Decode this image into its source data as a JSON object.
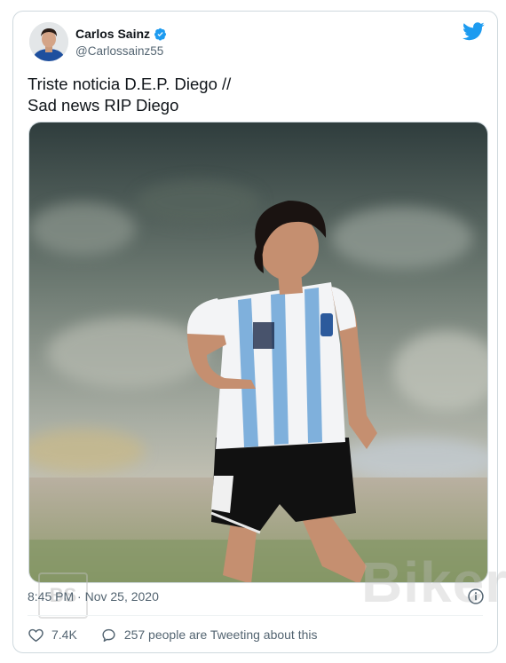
{
  "author": {
    "name": "Carlos Sainz",
    "handle": "@Carlossainz55",
    "verified": true
  },
  "tweet": {
    "text_lines": [
      "Triste noticia D.E.P. Diego //",
      "Sad news RIP Diego"
    ]
  },
  "meta": {
    "time": "8:45 PM",
    "separator": " · ",
    "date": "Nov 25, 2020"
  },
  "actions": {
    "likes": "7.4K",
    "conversation": "257 people are Tweeting about this"
  },
  "watermark": {
    "text": "Biker",
    "badge": "BS"
  },
  "icons": {
    "brand": "twitter-bird-icon",
    "verified": "verified-badge-icon",
    "info": "info-icon",
    "like": "heart-icon",
    "reply": "speech-bubble-icon"
  },
  "colors": {
    "twitter_blue": "#1d9bf0",
    "text_primary": "#0f1419",
    "text_secondary": "#536471",
    "border": "#cfd9de"
  }
}
